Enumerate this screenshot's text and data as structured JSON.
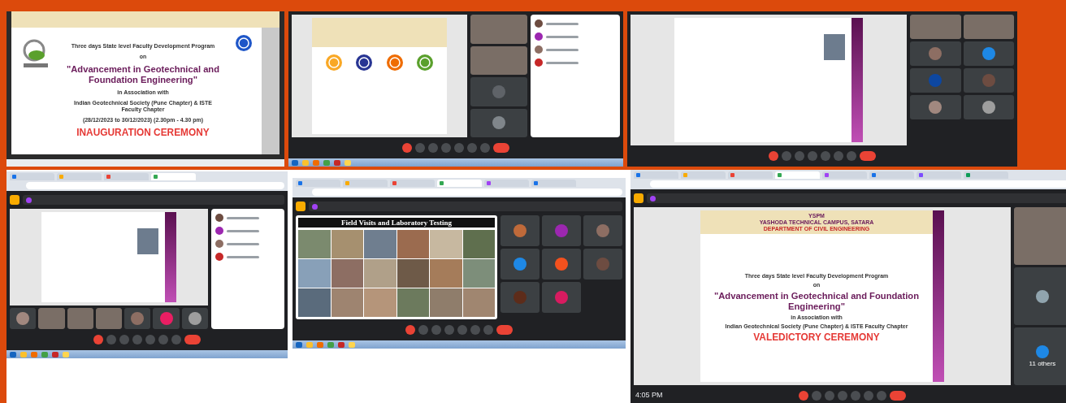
{
  "panels": [
    {
      "kind": "poster_only",
      "poster": {
        "lines": [
          {
            "kind": "plain",
            "text": "Three days State level Faculty Development Program"
          },
          {
            "kind": "plain",
            "text": "on"
          },
          {
            "kind": "title",
            "text": "\"Advancement in Geotechnical and Foundation Engineering\""
          },
          {
            "kind": "plain",
            "text": "in Association with"
          },
          {
            "kind": "plain",
            "text": "Indian Geotechnical Society (Pune Chapter) & ISTE Faculty Chapter"
          },
          {
            "kind": "plain",
            "text": "(28/12/2023 to 30/12/2023) (2.30pm - 4.30 pm)"
          },
          {
            "kind": "ceremony",
            "text": "INAUGURATION CEREMONY"
          }
        ]
      }
    },
    {
      "kind": "desktop_meeting",
      "mic_muted": true,
      "slide": {
        "kind": "logos"
      },
      "tiles": [
        {
          "kind": "video"
        },
        {
          "kind": "video"
        },
        {
          "kind": "avatar",
          "color": "#5f6368"
        },
        {
          "kind": "avatar",
          "color": "#80868b"
        }
      ]
    },
    {
      "kind": "meeting_grid",
      "mic_muted": true,
      "slide": {
        "kind": "speaker"
      },
      "tiles": [
        {
          "kind": "video"
        },
        {
          "kind": "video"
        },
        {
          "kind": "avatar",
          "color": "#8d6e63"
        },
        {
          "kind": "avatar",
          "color": "#1e88e5"
        },
        {
          "kind": "avatar",
          "color": "#0d47a1"
        },
        {
          "kind": "avatar",
          "color": "#6d4c41"
        },
        {
          "kind": "avatar",
          "color": "#a1887f"
        },
        {
          "kind": "avatar",
          "color": "#9e9e9e"
        }
      ]
    },
    {
      "kind": "browser_meeting_strip",
      "tabs": [
        {
          "selected": false
        },
        {
          "selected": false
        },
        {
          "selected": false
        },
        {
          "selected": true
        }
      ],
      "mic_muted": true,
      "slide": {
        "kind": "speaker"
      },
      "tiles": [
        {
          "kind": "avatar",
          "color": "#a1887f"
        },
        {
          "kind": "video"
        },
        {
          "kind": "video"
        },
        {
          "kind": "video"
        },
        {
          "kind": "avatar",
          "color": "#8d6e63"
        },
        {
          "kind": "avatar",
          "color": "#e91e63"
        },
        {
          "kind": "avatar",
          "color": "#9e9e9e"
        }
      ]
    },
    {
      "kind": "browser_meeting_grid",
      "tabs": [
        {
          "selected": false
        },
        {
          "selected": false
        },
        {
          "selected": false
        },
        {
          "selected": true
        },
        {
          "selected": false
        },
        {
          "selected": false
        }
      ],
      "mic_muted": true,
      "slide": {
        "kind": "photos",
        "title": "Field Visits and Laboratory Testing"
      },
      "tiles": [
        {
          "kind": "avatar",
          "color": "#bf6a3a"
        },
        {
          "kind": "avatar",
          "color": "#9c27b0"
        },
        {
          "kind": "avatar",
          "color": "#8d6e63"
        },
        {
          "kind": "avatar",
          "color": "#1e88e5"
        },
        {
          "kind": "avatar",
          "color": "#f4511e"
        },
        {
          "kind": "avatar",
          "color": "#6d4c41"
        },
        {
          "kind": "avatar",
          "color": "#5d2c1a"
        },
        {
          "kind": "avatar",
          "color": "#d81b60"
        }
      ]
    },
    {
      "kind": "browser_meeting_column",
      "tabs": [
        {
          "selected": false
        },
        {
          "selected": false
        },
        {
          "selected": false
        },
        {
          "selected": true
        },
        {
          "selected": false
        },
        {
          "selected": false
        },
        {
          "selected": false
        },
        {
          "selected": false
        }
      ],
      "mic_muted": true,
      "slide": {
        "kind": "poster",
        "header": [
          "YSPM",
          "YASHODA TECHNICAL CAMPUS, SATARA",
          "DEPARTMENT OF CIVIL ENGINEERING"
        ],
        "lines": [
          {
            "kind": "plain",
            "text": "Three days State level Faculty Development Program"
          },
          {
            "kind": "plain",
            "text": "on"
          },
          {
            "kind": "title",
            "text": "\"Advancement in Geotechnical and Foundation Engineering\""
          },
          {
            "kind": "plain",
            "text": "in Association with"
          },
          {
            "kind": "plain",
            "text": "Indian Geotechnical Society (Pune Chapter) & ISTE Faculty Chapter"
          },
          {
            "kind": "ceremony",
            "text": "VALEDICTORY CEREMONY"
          }
        ]
      },
      "tiles": [
        {
          "kind": "video"
        },
        {
          "kind": "avatar",
          "color": "#90a4ae"
        },
        {
          "kind": "group",
          "label": "11 others",
          "color": "#1e88e5"
        }
      ],
      "time": "4:05 PM"
    }
  ]
}
